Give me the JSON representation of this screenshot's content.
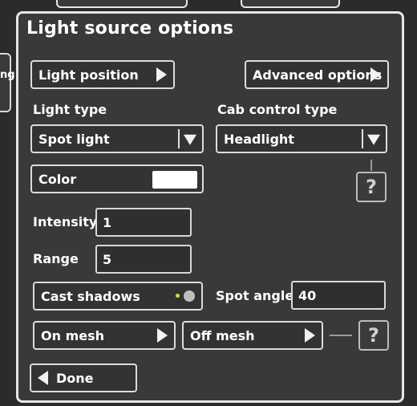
{
  "background": {
    "left_tab_fragment": "ng"
  },
  "panel": {
    "title": "Light source options",
    "light_position_label": "Light position",
    "advanced_options_label": "Advanced options",
    "light_type_heading": "Light type",
    "light_type_value": "Spot light",
    "cab_control_heading": "Cab control type",
    "cab_control_value": "Headlight",
    "color_label": "Color",
    "color_value": "#ffffff",
    "intensity_label": "Intensity",
    "intensity_value": "1",
    "range_label": "Range",
    "range_value": "5",
    "cast_shadows_label": "Cast shadows",
    "cast_shadows_on": true,
    "spot_angle_label": "Spot angle",
    "spot_angle_value": "40",
    "on_mesh_label": "On mesh",
    "off_mesh_label": "Off mesh",
    "help_glyph": "?",
    "done_label": "Done"
  },
  "colors": {
    "panel_bg": "#393939",
    "border": "#e6e6e6",
    "toggle_indicator": "#c8e04a"
  }
}
